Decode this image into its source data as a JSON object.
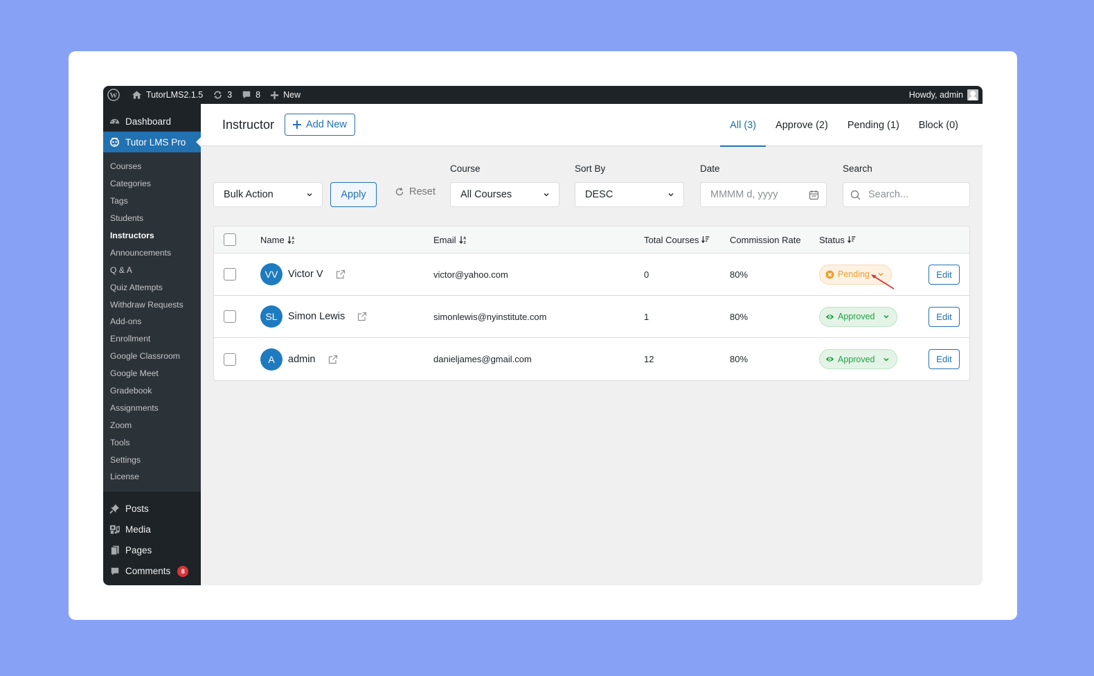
{
  "adminbar": {
    "site_name": "TutorLMS2.1.5",
    "updates_count": "3",
    "comments_count": "8",
    "new_label": "New",
    "greeting": "Howdy, admin"
  },
  "sidebar": {
    "dashboard": "Dashboard",
    "plugin": "Tutor LMS Pro",
    "submenu": [
      {
        "label": "Courses"
      },
      {
        "label": "Categories"
      },
      {
        "label": "Tags"
      },
      {
        "label": "Students"
      },
      {
        "label": "Instructors",
        "current": true
      },
      {
        "label": "Announcements"
      },
      {
        "label": "Q & A"
      },
      {
        "label": "Quiz Attempts"
      },
      {
        "label": "Withdraw Requests"
      },
      {
        "label": "Add-ons"
      },
      {
        "label": "Enrollment"
      },
      {
        "label": "Google Classroom"
      },
      {
        "label": "Google Meet"
      },
      {
        "label": "Gradebook"
      },
      {
        "label": "Assignments"
      },
      {
        "label": "Zoom"
      },
      {
        "label": "Tools"
      },
      {
        "label": "Settings"
      },
      {
        "label": "License"
      }
    ],
    "bottom": {
      "posts": "Posts",
      "media": "Media",
      "pages": "Pages",
      "comments": "Comments",
      "comments_badge": "8"
    }
  },
  "header": {
    "title": "Instructor",
    "add_new": "Add New",
    "tabs": [
      {
        "label": "All (3)",
        "active": true
      },
      {
        "label": "Approve (2)"
      },
      {
        "label": "Pending (1)"
      },
      {
        "label": "Block (0)"
      }
    ]
  },
  "filters": {
    "bulk_action": "Bulk Action",
    "apply": "Apply",
    "reset": "Reset",
    "course_label": "Course",
    "course_value": "All Courses",
    "sort_label": "Sort By",
    "sort_value": "DESC",
    "date_label": "Date",
    "date_placeholder": "MMMM d, yyyy",
    "search_label": "Search",
    "search_placeholder": "Search..."
  },
  "table": {
    "columns": {
      "name": "Name",
      "email": "Email",
      "total_courses": "Total Courses",
      "commission_rate": "Commission Rate",
      "status": "Status"
    },
    "rows": [
      {
        "initials": "VV",
        "name": "Victor V",
        "email": "victor@yahoo.com",
        "total_courses": "0",
        "commission": "80%",
        "status": "Pending",
        "status_type": "pending",
        "action": "Edit"
      },
      {
        "initials": "SL",
        "name": "Simon Lewis",
        "email": "simonlewis@nyinstitute.com",
        "total_courses": "1",
        "commission": "80%",
        "status": "Approved",
        "status_type": "approved",
        "action": "Edit"
      },
      {
        "initials": "A",
        "name": "admin",
        "email": "danieljames@gmail.com",
        "total_courses": "12",
        "commission": "80%",
        "status": "Approved",
        "status_type": "approved",
        "action": "Edit"
      }
    ]
  },
  "colors": {
    "background": "#87a2f5",
    "accent": "#2271b1",
    "pending": "#e8a035",
    "approved": "#24a148",
    "annotation_arrow": "#d63638"
  }
}
